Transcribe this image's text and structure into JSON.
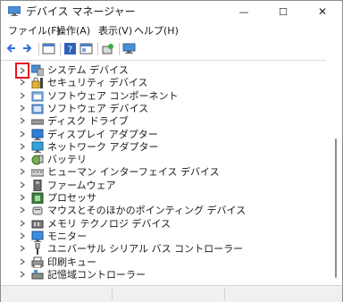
{
  "window": {
    "title": "デバイス マネージャー"
  },
  "window_controls": [
    {
      "name": "minimize-button",
      "glyph": "—"
    },
    {
      "name": "maximize-button",
      "glyph": "☐"
    },
    {
      "name": "close-button",
      "glyph": "✕"
    }
  ],
  "menu": [
    {
      "name": "menu-file",
      "label": "ファイル(F)"
    },
    {
      "name": "menu-action",
      "label": "操作(A)"
    },
    {
      "name": "menu-view",
      "label": "表示(V)"
    },
    {
      "name": "menu-help",
      "label": "ヘルプ(H)"
    }
  ],
  "toolbar": [
    {
      "name": "back-icon"
    },
    {
      "name": "forward-icon"
    },
    {
      "sep": true
    },
    {
      "name": "properties-icon"
    },
    {
      "sep": true
    },
    {
      "name": "help-icon"
    },
    {
      "name": "action-pane-icon"
    },
    {
      "sep": true
    },
    {
      "name": "update-driver-icon"
    },
    {
      "sep": true
    },
    {
      "name": "scan-hardware-icon"
    }
  ],
  "tree": {
    "items": [
      {
        "label": "システム デバイス",
        "icon": "system-devices-icon",
        "focused": true
      },
      {
        "label": "セキュリティ デバイス",
        "icon": "security-devices-icon"
      },
      {
        "label": "ソフトウェア コンポーネント",
        "icon": "software-components-icon"
      },
      {
        "label": "ソフトウェア デバイス",
        "icon": "software-devices-icon"
      },
      {
        "label": "ディスク ドライブ",
        "icon": "disk-drive-icon"
      },
      {
        "label": "ディスプレイ アダプター",
        "icon": "display-adapter-icon"
      },
      {
        "label": "ネットワーク アダプター",
        "icon": "network-adapter-icon"
      },
      {
        "label": "バッテリ",
        "icon": "battery-icon"
      },
      {
        "label": "ヒューマン インターフェイス デバイス",
        "icon": "hid-icon"
      },
      {
        "label": "ファームウェア",
        "icon": "firmware-icon"
      },
      {
        "label": "プロセッサ",
        "icon": "processor-icon"
      },
      {
        "label": "マウスとそのほかのポインティング デバイス",
        "icon": "mouse-icon"
      },
      {
        "label": "メモリ テクノロジ デバイス",
        "icon": "memory-technology-icon"
      },
      {
        "label": "モニター",
        "icon": "monitor-icon"
      },
      {
        "label": "ユニバーサル シリアル バス コントローラー",
        "icon": "usb-controller-icon"
      },
      {
        "label": "印刷キュー",
        "icon": "print-queue-icon"
      },
      {
        "label": "記憶域コントローラー",
        "icon": "storage-controller-icon"
      }
    ]
  },
  "colors": {
    "accent": "#0a64d6",
    "focus": "#e81123"
  }
}
